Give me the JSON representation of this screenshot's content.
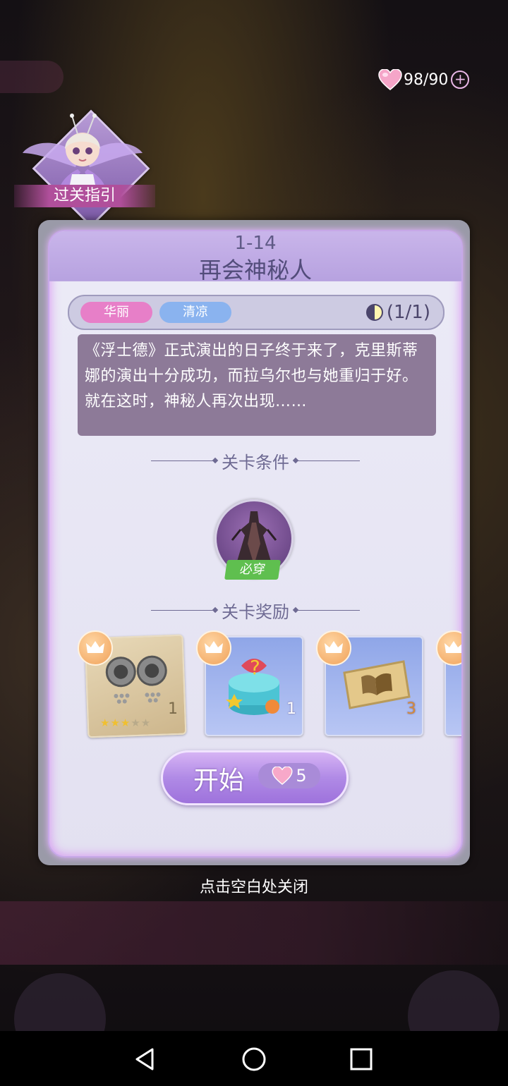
{
  "status": {
    "hearts_value": "98/90",
    "heart_icon": "heart-icon",
    "add_icon": "plus-icon"
  },
  "guide": {
    "label": "过关指引"
  },
  "stage": {
    "number": "1-14",
    "title": "再会神秘人",
    "tags": [
      "华丽",
      "清凉"
    ],
    "attempts": "(1/1)",
    "story": "《浮士德》正式演出的日子终于来了，克里斯蒂娜的演出十分成功，而拉乌尔也与她重归于好。就在这时，神秘人再次出现……"
  },
  "conditions": {
    "title": "关卡条件",
    "item_badge": "必穿"
  },
  "rewards": {
    "title": "关卡奖励",
    "items": [
      {
        "icon": "earrings-design-icon",
        "count": "1",
        "stars_on": 3,
        "stars_total": 5
      },
      {
        "icon": "mystery-gift-icon",
        "count": "1"
      },
      {
        "icon": "ticket-book-icon",
        "count": "3"
      }
    ]
  },
  "start": {
    "label": "开始",
    "cost": "5"
  },
  "close_hint": "点击空白处关闭",
  "colors": {
    "accent": "#b08ae6",
    "tag_pink": "#e77fc8",
    "tag_blue": "#8ab3ef",
    "must_wear_green": "#5fbf4f"
  }
}
